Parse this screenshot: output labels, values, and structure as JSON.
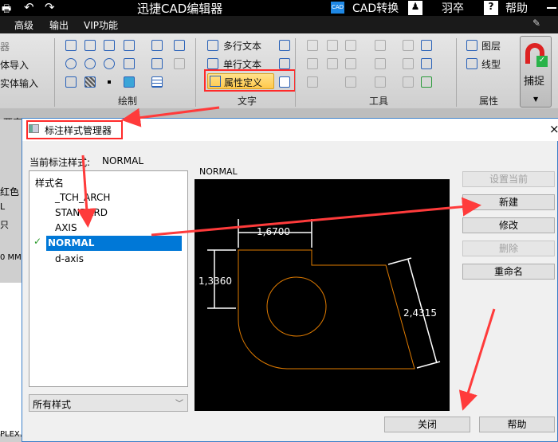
{
  "app": {
    "title": "迅捷CAD编辑器",
    "cad_convert": "CAD转换",
    "user": "羽卒",
    "help": "帮助"
  },
  "menu": [
    "高级",
    "输出",
    "VIP功能"
  ],
  "ribbon": {
    "left_items": [
      "器",
      "体导入",
      "实体输入"
    ],
    "draw_group": "绘制",
    "text_group": "文字",
    "multiline_text": "多行文本",
    "single_text": "单行文本",
    "attr_def": "属性定义",
    "tools_group": "工具",
    "props_group": "属性",
    "layer": "图层",
    "linetype": "线型",
    "snap": "捕捉"
  },
  "doc_tab": "两直",
  "left_panel": [
    "红色",
    "L",
    "只",
    "0 MM",
    "PLEX."
  ],
  "dialog": {
    "title": "标注样式管理器",
    "current_label": "当前标注样式:",
    "current_value": "NORMAL",
    "list_header": "样式名",
    "styles": [
      "_TCH_ARCH",
      "STANDARD",
      "AXIS",
      "NORMAL",
      "d-axis"
    ],
    "selected": "NORMAL",
    "filter": "所有样式",
    "preview_label": "NORMAL",
    "preview_dims": [
      "1,6700",
      "1,3360",
      "2,4315"
    ],
    "buttons": {
      "set_current": "设置当前",
      "new": "新建",
      "modify": "修改",
      "delete": "删除",
      "rename": "重命名",
      "close": "关闭",
      "help": "帮助"
    }
  },
  "colors": {
    "accent": "#0078d7",
    "annotation": "#ff3b3b",
    "drawing": "#e07b00"
  }
}
